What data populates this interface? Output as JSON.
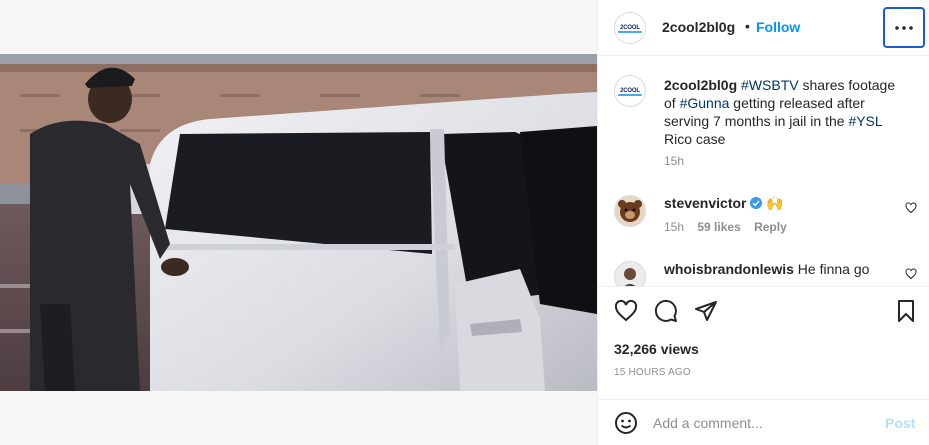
{
  "video": {
    "mute_icon": "speaker-muted-icon"
  },
  "header": {
    "username": "2cool2bl0g",
    "separator": "•",
    "follow_label": "Follow",
    "avatar_logo": "2COOL",
    "more_icon": "more-horizontal-icon"
  },
  "caption": {
    "username": "2cool2bl0g",
    "tag_1": "#WSBTV",
    "text_1": " shares footage of ",
    "tag_2": "#Gunna",
    "text_2": " getting released after serving 7 months in jail in the ",
    "tag_3": "#YSL",
    "text_3": " Rico case",
    "time": "15h"
  },
  "comments": [
    {
      "username": "stevenvictor",
      "verified": true,
      "text": "🙌",
      "time": "15h",
      "likes": "59 likes",
      "reply_label": "Reply"
    },
    {
      "username": "whoisbrandonlewis",
      "text": "He finna go"
    }
  ],
  "actions": {
    "like_icon": "heart-icon",
    "comment_icon": "comment-icon",
    "share_icon": "paper-plane-icon",
    "save_icon": "bookmark-icon",
    "views": "32,266 views",
    "posted": "15 HOURS AGO"
  },
  "add_comment": {
    "placeholder": "Add a comment...",
    "post_label": "Post",
    "emoji_icon": "smiley-icon"
  },
  "colors": {
    "link": "#0095f6",
    "hashtag": "#00376b",
    "secondary": "#8e8e8e",
    "verified": "#3897f0"
  }
}
